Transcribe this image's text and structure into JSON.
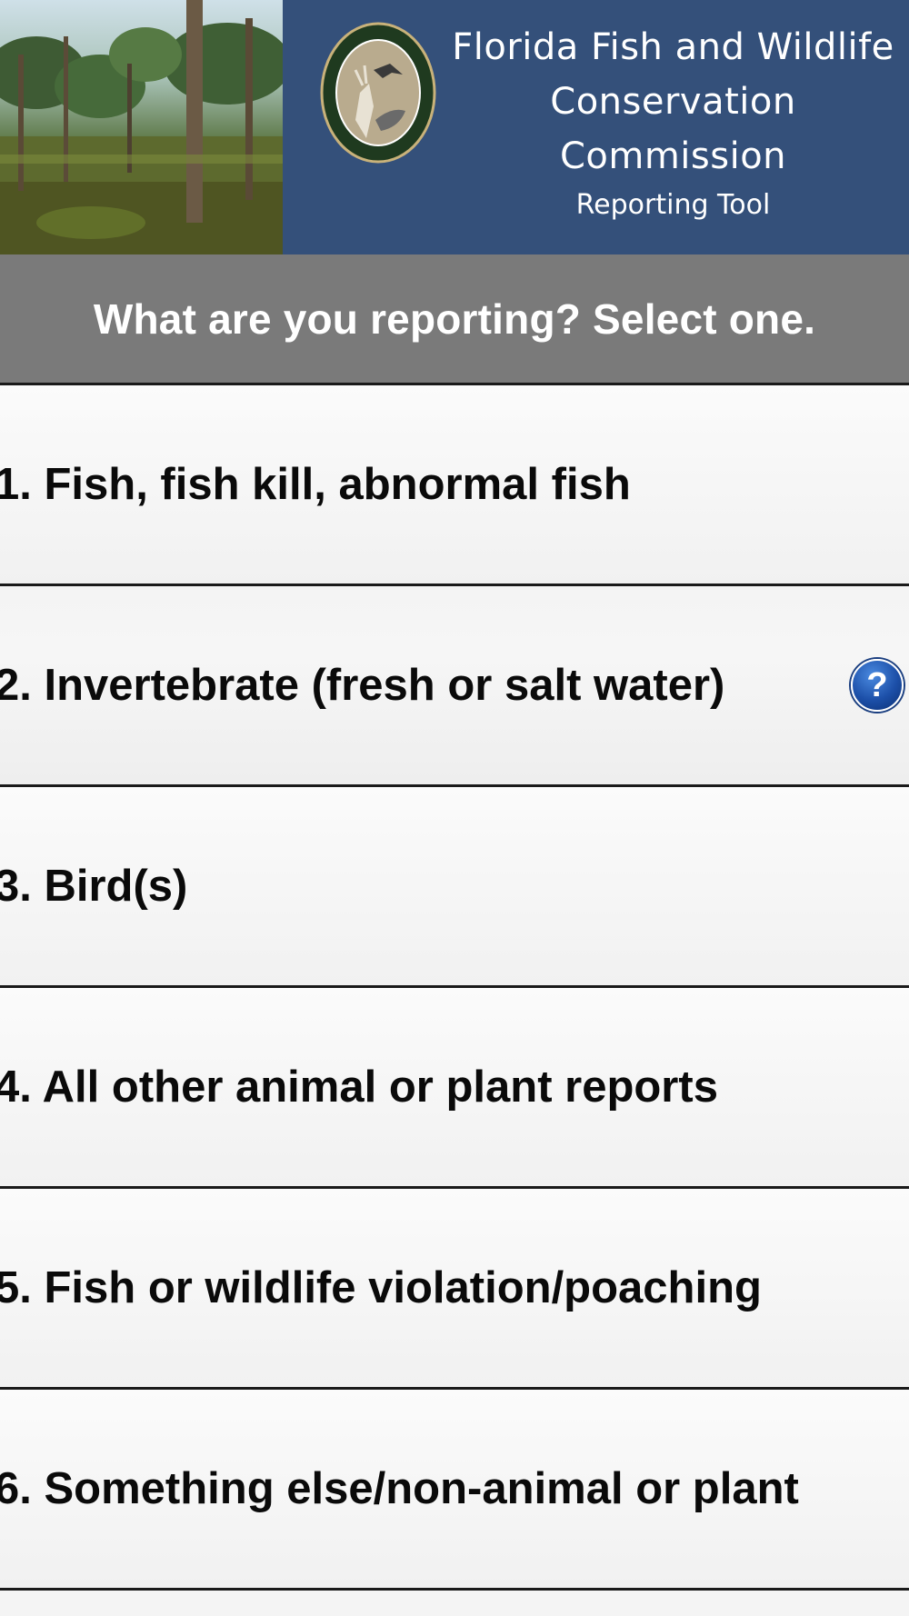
{
  "header": {
    "title_line1": "Florida Fish and Wildlife",
    "title_line2": "Conservation Commission",
    "subtitle": "Reporting Tool",
    "seal_text": "FLORIDA FISH AND WILDLIFE CONSERVATION COMMISSION",
    "brand_color": "#34507a"
  },
  "prompt": {
    "text": "What are you reporting? Select one."
  },
  "options": [
    {
      "label": "1. Fish, fish kill, abnormal fish"
    },
    {
      "label": "2. Invertebrate (fresh or salt water)",
      "help_icon": "question-mark-icon"
    },
    {
      "label": "3. Bird(s)"
    },
    {
      "label": "4. All other animal or plant reports"
    },
    {
      "label": "5. Fish or wildlife violation/poaching"
    },
    {
      "label": "6. Something else/non-animal or plant"
    }
  ],
  "help_icon_glyph": "?"
}
